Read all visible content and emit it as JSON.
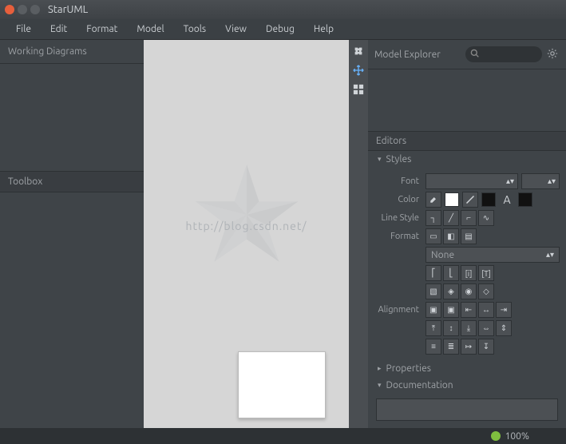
{
  "window": {
    "title": "StarUML"
  },
  "menu": {
    "items": [
      "File",
      "Edit",
      "Format",
      "Model",
      "Tools",
      "View",
      "Debug",
      "Help"
    ]
  },
  "leftPanels": {
    "workingDiagrams": "Working Diagrams",
    "toolbox": "Toolbox"
  },
  "canvas": {
    "watermark": "http://blog.csdn.net/"
  },
  "rightTop": {
    "modelExplorer": "Model Explorer",
    "searchPlaceholder": ""
  },
  "editors": {
    "header": "Editors",
    "styles": {
      "header": "Styles",
      "fontLabel": "Font",
      "colorLabel": "Color",
      "lineStyleLabel": "Line Style",
      "formatLabel": "Format",
      "formatCombo": "None",
      "alignmentLabel": "Alignment"
    },
    "properties": {
      "header": "Properties"
    },
    "documentation": {
      "header": "Documentation",
      "value": ""
    }
  },
  "status": {
    "zoom": "100%"
  }
}
